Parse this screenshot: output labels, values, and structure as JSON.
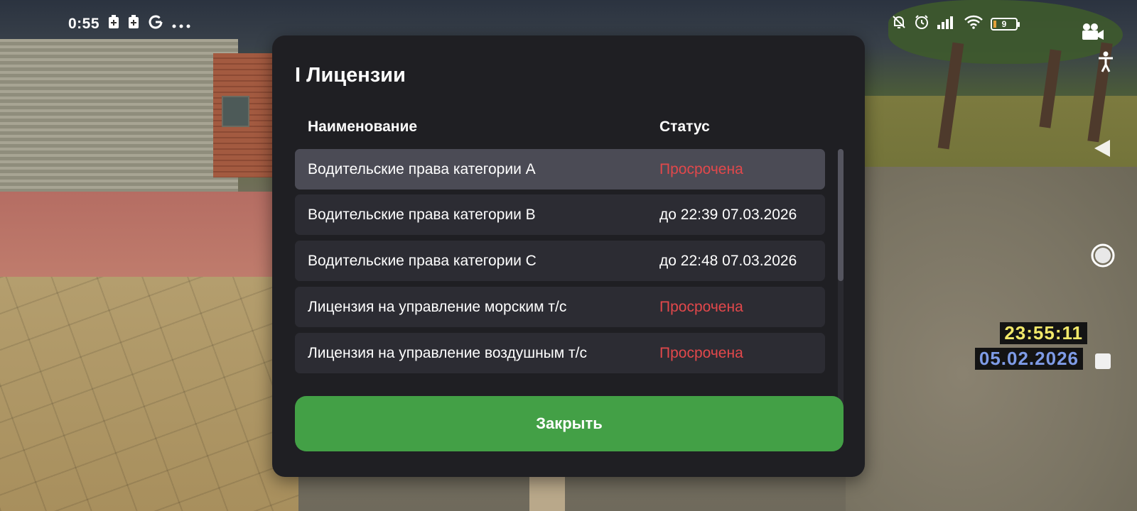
{
  "status_bar": {
    "time": "0:55",
    "left_icons": [
      "battery-saver-icon",
      "battery-saver-icon",
      "google-icon",
      "more-dots-icon"
    ],
    "right_icons": [
      "muted-bell-icon",
      "alarm-icon",
      "signal-icon",
      "wifi-icon"
    ],
    "battery_level": "9",
    "battery_color": "#e3a13a"
  },
  "game_hud": {
    "time": "23:55:11",
    "date": "05.02.2026",
    "time_color": "#f2e96a",
    "date_color": "#7e9be6"
  },
  "dialog": {
    "title": "I Лицензии",
    "columns": {
      "name": "Наименование",
      "status": "Статус"
    },
    "rows": [
      {
        "name": "Водительские права категории A",
        "status": "Просрочена",
        "expired": true,
        "selected": true
      },
      {
        "name": "Водительские права категории B",
        "status": "до 22:39 07.03.2026",
        "expired": false,
        "selected": false
      },
      {
        "name": "Водительские права категории C",
        "status": "до 22:48 07.03.2026",
        "expired": false,
        "selected": false
      },
      {
        "name": "Лицензия на управление морским т/с",
        "status": "Просрочена",
        "expired": true,
        "selected": false
      },
      {
        "name": "Лицензия на управление воздушным т/с",
        "status": "Просрочена",
        "expired": true,
        "selected": false
      }
    ],
    "close_label": "Закрыть",
    "colors": {
      "accent": "#43a046",
      "expired": "#e2484b",
      "panel": "#1f1f23"
    }
  }
}
